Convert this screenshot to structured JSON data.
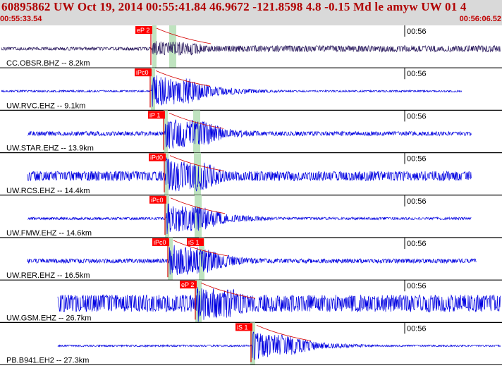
{
  "header": {
    "title": "60895862 UW Oct 19, 2014 00:55:41.84   46.9672 -121.8598  4.8 -0.15 Md le amyw UW 01   4",
    "start_time": "00:55:33.54",
    "end_time": "00:56:06.52"
  },
  "colors": {
    "header_bg": "#d9d9d9",
    "header_text": "#b00000",
    "trace_first": "#2a1a5e",
    "trace": "#0000e0",
    "pick_box": "#ff0000",
    "pick_line": "#d40000",
    "window": "#bfe3bf",
    "grid": "#000000"
  },
  "time_tick_label": "00:56",
  "traces": [
    {
      "label": "CC.OBSR.BHZ -- 8.2km",
      "pick": "eP 2",
      "pick2": "",
      "start": 0.0,
      "end": 1.0,
      "amp": 0.28,
      "noise": 0.35,
      "onset": 0.3
    },
    {
      "label": "UW.RVC.EHZ -- 9.1km",
      "pick": "iPc0",
      "pick2": "",
      "start": 0.0,
      "end": 0.92,
      "amp": 0.55,
      "noise": 0.05,
      "onset": 0.3
    },
    {
      "label": "UW.STAR.EHZ -- 13.9km",
      "pick": "iP 1",
      "pick2": "",
      "start": 0.03,
      "end": 0.94,
      "amp": 0.55,
      "noise": 0.12,
      "onset": 0.32
    },
    {
      "label": "UW.RCS.EHZ -- 14.4km",
      "pick": "iPd0",
      "pick2": "",
      "start": 0.03,
      "end": 0.94,
      "amp": 0.6,
      "noise": 0.25,
      "onset": 0.32
    },
    {
      "label": "UW.FMW.EHZ -- 14.6km",
      "pick": "iPc0",
      "pick2": "",
      "start": 0.03,
      "end": 0.94,
      "amp": 0.5,
      "noise": 0.08,
      "onset": 0.33
    },
    {
      "label": "UW.RER.EHZ -- 16.5km",
      "pick": "iPc0",
      "pick2": "iS 1",
      "start": 0.03,
      "end": 0.95,
      "amp": 0.55,
      "noise": 0.12,
      "onset": 0.34
    },
    {
      "label": "UW.GSM.EHZ -- 26.7km",
      "pick": "eP 2",
      "pick2": "",
      "start": 0.09,
      "end": 1.0,
      "amp": 0.6,
      "noise": 0.45,
      "onset": 0.39
    },
    {
      "label": "PB.B941.EH2 -- 27.3km",
      "pick": "iS 1",
      "pick2": "",
      "start": 0.09,
      "end": 1.0,
      "amp": 0.45,
      "noise": 0.06,
      "onset": 0.5
    }
  ]
}
